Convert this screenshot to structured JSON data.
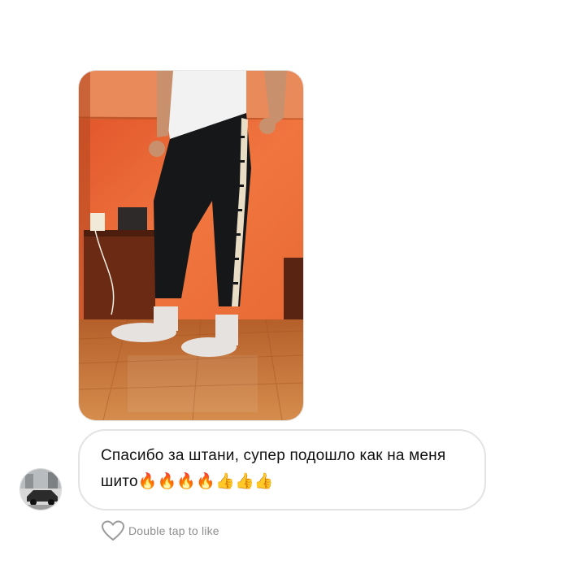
{
  "message": {
    "text": "Спасибо за штани, супер подошло как на меня шито🔥🔥🔥🔥👍👍👍"
  },
  "photo": {
    "icon": "photo-of-person-in-track-pants"
  },
  "avatar": {
    "icon": "user-avatar-car"
  },
  "like": {
    "icon": "heart-outline-icon",
    "label": "Double tap to like"
  },
  "colors": {
    "bubble_border": "#e3e3e3",
    "hint_text": "#8e8e8e",
    "wall": "#e8693a"
  }
}
